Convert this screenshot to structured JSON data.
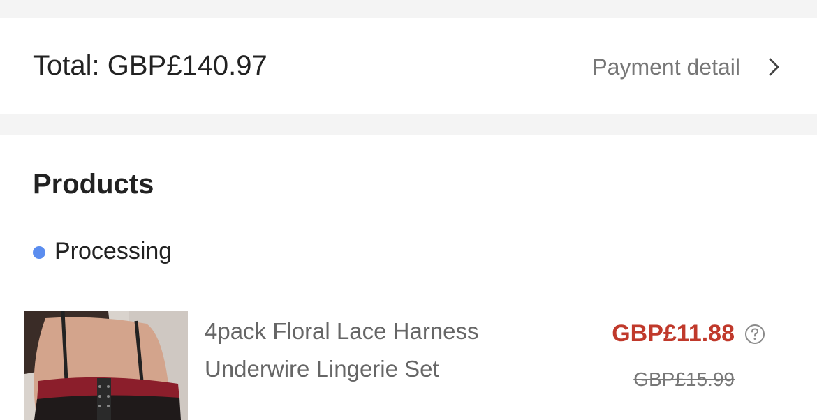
{
  "order_summary": {
    "total_text": "Total: GBP£140.97",
    "payment_detail_label": "Payment detail",
    "chevron_icon": "chevron-right-icon"
  },
  "products_section": {
    "heading": "Products",
    "status": {
      "label": "Processing",
      "dot_color": "#5b8def"
    },
    "items": [
      {
        "title": "4pack Floral Lace Harness Underwire Lingerie Set",
        "sale_price": "GBP£11.88",
        "original_price": "GBP£15.99",
        "sale_price_color": "#c0392b",
        "help_icon": "question-circle-icon"
      }
    ]
  }
}
